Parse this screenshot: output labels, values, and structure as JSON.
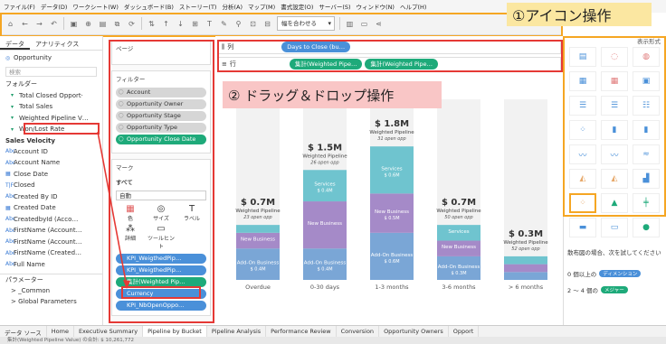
{
  "menu": [
    "ファイル(F)",
    "データ(D)",
    "ワークシート(W)",
    "ダッシュボード(B)",
    "ストーリー(T)",
    "分析(A)",
    "マップ(M)",
    "書式設定(O)",
    "サーバー(S)",
    "ウィンドウ(N)",
    "ヘルプ(H)"
  ],
  "toolbar": {
    "fit_label": "幅を合わせる"
  },
  "callouts": {
    "icon_ops": "①アイコン操作",
    "drag_drop": "② ドラッグ＆ドロップ操作"
  },
  "left": {
    "tabs": [
      "データ",
      "アナリティクス"
    ],
    "datasource": "Opportunity",
    "search_placeholder": "検索",
    "folder_label": "フォルダー",
    "folder_fields": [
      "Total Closed Opport·",
      "Total Sales",
      "Weighted Pipeline V…",
      "Won/Lost Rate"
    ],
    "group_label": "Sales Velocity",
    "fields": [
      "Account ID",
      "Account Name",
      "Close Date",
      "Closed",
      "Created By ID",
      "Created Date",
      "CreatedbyId (Acco…",
      "FirstName (Account…",
      "FirstName (Account…",
      "FirstName (Created…",
      "Full Name"
    ],
    "params_label": "パラメーター",
    "params": [
      "> _Common",
      "> Global Parameters"
    ]
  },
  "shelves": {
    "pages_label": "ページ",
    "filters_label": "フィルター",
    "filters": [
      "Account",
      "Opportunity Owner",
      "Opportunity Stage",
      "Opportunity Type",
      "Opportunity Close Date"
    ],
    "marks_label": "マーク",
    "marks_all": "すべて",
    "marks_type": "自動",
    "marks_buttons": [
      "色",
      "サイズ",
      "ラベル",
      "詳細",
      "ツールヒント"
    ],
    "marks_pills": [
      "KPI_WeigthedPip…",
      "KPI_WeigthedPip…",
      "集計(Weighted Pip…",
      "Currency",
      "KPI_NbOpenOppo…"
    ],
    "columns_label": "列",
    "rows_label": "行",
    "columns_pill": "Days to Close (bu…",
    "rows_pills": [
      "集計(Weighted Pipe…",
      "集計(Weighted Pipe…"
    ]
  },
  "chart_data": {
    "type": "bar",
    "categories": [
      "Overdue",
      "0-30 days",
      "1-3 months",
      "3-6 months",
      "> 6 months"
    ],
    "totals": [
      "$ 0.7M",
      "$ 1.5M",
      "$ 1.8M",
      "$ 0.7M",
      "$ 0.3M"
    ],
    "totals_values": [
      0.7,
      1.5,
      1.8,
      0.7,
      0.3
    ],
    "sub_label": "Weighted Pipeline",
    "open_opps": [
      "23 open opp",
      "26 open opp",
      "31 open opp",
      "50 open opp",
      "52 open opp"
    ],
    "segments": [
      {
        "name": "Add-On Business",
        "values": [
          0.4,
          0.4,
          0.6,
          0.3,
          0.1
        ],
        "labels": [
          "$ 0.4M",
          "$ 0.4M",
          "$ 0.6M",
          "$ 0.3M",
          ""
        ],
        "color": "#7aa6d6"
      },
      {
        "name": "New Business",
        "values": [
          0.2,
          0.6,
          0.5,
          0.2,
          0.1
        ],
        "labels": [
          "",
          "",
          "$ 0.5M",
          "",
          ""
        ],
        "color": "#a58ac8"
      },
      {
        "name": "Services",
        "values": [
          0.1,
          0.4,
          0.6,
          0.2,
          0.1
        ],
        "labels": [
          "",
          "$ 0.4M",
          "$ 0.6M",
          "",
          ""
        ],
        "color": "#6fc4cf"
      }
    ],
    "ylim": [
      0,
      2.3
    ]
  },
  "right": {
    "show_me_label": "表示形式",
    "hint_title": "散布図の場合、次を試してください",
    "hint_rows": [
      {
        "text": "0 個以上の",
        "badge": "ディメンション"
      },
      {
        "text": "2 ～ 4 個の",
        "badge": "メジャー"
      }
    ]
  },
  "tabs": [
    "Home",
    "Executive Summary",
    "Pipeline by Bucket",
    "Pipeline Analysis",
    "Performance Review",
    "Conversion",
    "Opportunity Owners",
    "Opport"
  ],
  "active_tab": "Pipeline by Bucket",
  "datasource_tab": "データ ソース",
  "status_text": "集計(Weighted Pipeline Value) の合計: $ 10,261,772",
  "colors": {
    "accent_green": "#1eaa7a",
    "accent_blue": "#4a90d9",
    "highlight_orange": "#f5a623",
    "highlight_red": "#e53935"
  }
}
